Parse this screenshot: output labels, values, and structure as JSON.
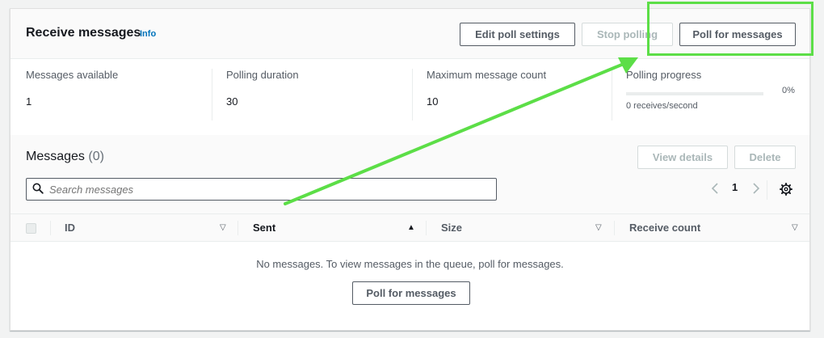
{
  "header": {
    "title": "Receive messages",
    "info_label": "Info",
    "edit_poll_settings_label": "Edit poll settings",
    "stop_polling_label": "Stop polling",
    "poll_for_messages_label": "Poll for messages"
  },
  "stats": {
    "messages_available": {
      "label": "Messages available",
      "value": "1"
    },
    "polling_duration": {
      "label": "Polling duration",
      "value": "30"
    },
    "max_message_count": {
      "label": "Maximum message count",
      "value": "10"
    },
    "polling_progress": {
      "label": "Polling progress",
      "percent_label": "0%",
      "percent": 0,
      "rate": "0 receives/second"
    }
  },
  "messages": {
    "title": "Messages",
    "count": "(0)",
    "view_details_label": "View details",
    "delete_label": "Delete",
    "search_placeholder": "Search messages",
    "current_page": "1"
  },
  "table": {
    "columns": [
      {
        "label": "ID",
        "sort": "none"
      },
      {
        "label": "Sent",
        "sort": "ascending"
      },
      {
        "label": "Size",
        "sort": "none"
      },
      {
        "label": "Receive count",
        "sort": "none"
      }
    ],
    "empty_text": "No messages. To view messages in the queue, poll for messages.",
    "empty_button_label": "Poll for messages"
  },
  "annotation": {
    "color": "#5cde47"
  }
}
